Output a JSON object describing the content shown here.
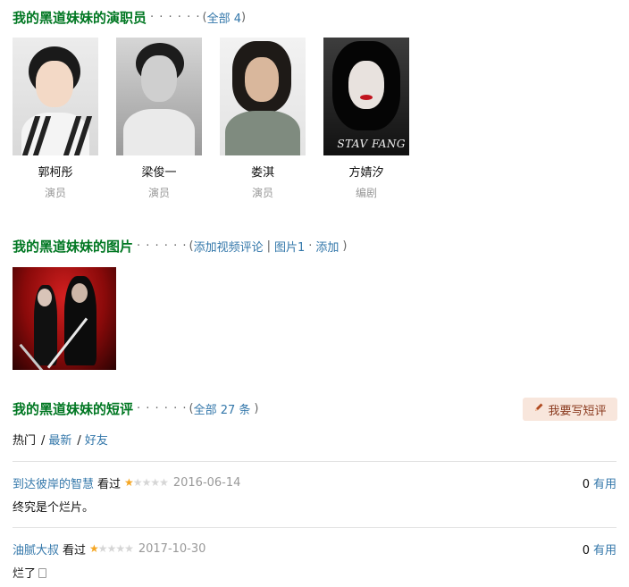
{
  "cast_section": {
    "title": "我的黑道妹妹的演职员",
    "dots": "· · · · · ·",
    "open_paren": "(",
    "all_link": "全部 4",
    "close_paren": ")",
    "members": [
      {
        "name": "郭柯彤",
        "role": "演员"
      },
      {
        "name": "梁俊一",
        "role": "演员"
      },
      {
        "name": "娄淇",
        "role": "演员"
      },
      {
        "name": "方婧汐",
        "role": "编剧",
        "photo_caption": "STAV FANG"
      }
    ]
  },
  "photos_section": {
    "title": "我的黑道妹妹的图片",
    "dots": "· · · · · ·",
    "open_paren": "(",
    "add_video_link": "添加视频评论",
    "pipe": "|",
    "photos_link": "图片1",
    "middot": "·",
    "add_link": "添加",
    "close_paren": ")"
  },
  "reviews_section": {
    "title": "我的黑道妹妹的短评",
    "dots": "· · · · · ·",
    "open_paren": "(",
    "all_link": "全部 27 条",
    "close_paren": ")",
    "write_button": "我要写短评",
    "filters": {
      "hot": "热门",
      "sep1": "/",
      "latest": "最新",
      "sep2": "/",
      "friends": "好友"
    },
    "reviews": [
      {
        "user": "到达彼岸的智慧",
        "status": "看过",
        "rating": 1,
        "date": "2016-06-14",
        "useful_count": "0",
        "useful_label": "有用",
        "text": "终究是个烂片。"
      },
      {
        "user": "油腻大叔",
        "status": "看过",
        "rating": 1,
        "date": "2017-10-30",
        "useful_count": "0",
        "useful_label": "有用",
        "text": "烂了"
      }
    ]
  },
  "icons": {
    "pencil": "pencil-icon",
    "star": "star-icon",
    "note": "note-icon"
  },
  "colors": {
    "section_title": "#007722",
    "link": "#3377aa",
    "star": "#f5a623",
    "write_button_bg": "#f8e6dc"
  }
}
